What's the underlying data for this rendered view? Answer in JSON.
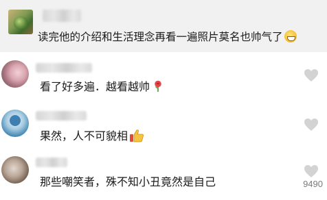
{
  "post": {
    "text": "读完他的介绍和生活理念再看一遍照片莫名也帅气了",
    "emoji": "grinning-face-icon"
  },
  "comments": [
    {
      "text": "看了好多遍．越看越帅",
      "emoji": "rose-icon",
      "liked": false
    },
    {
      "text": "果然，人不可貌相",
      "emoji": "thumbs-up-icon",
      "liked": false
    },
    {
      "text": "那些嘲笑者，殊不知小丑竟然是自己",
      "emoji": "",
      "liked": false
    }
  ],
  "footer": {
    "count": "9490"
  },
  "colors": {
    "heart": "#cfcfcf",
    "post_bg": "#f1f1f1"
  }
}
